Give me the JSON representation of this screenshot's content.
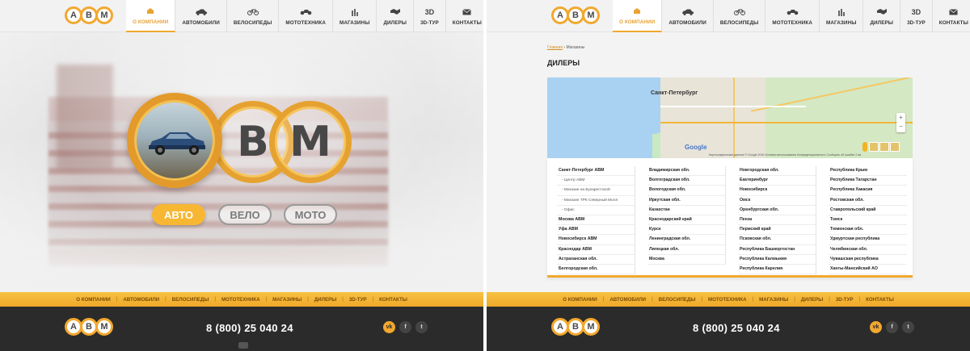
{
  "logo": {
    "letters": [
      "А",
      "В",
      "М"
    ]
  },
  "nav": [
    {
      "label": "О компании",
      "icon": "home-icon"
    },
    {
      "label": "Автомобили",
      "icon": "car-icon"
    },
    {
      "label": "Велосипеды",
      "icon": "bicycle-icon"
    },
    {
      "label": "Мототехника",
      "icon": "motorcycle-icon"
    },
    {
      "label": "Магазины",
      "icon": "shop-icon"
    },
    {
      "label": "Дилеры",
      "icon": "handshake-icon"
    },
    {
      "label": "3D-тур",
      "icon": "3d-icon",
      "icon_text": "3D"
    },
    {
      "label": "Контакты",
      "icon": "envelope-icon"
    }
  ],
  "hero": {
    "ring_letters": [
      "В",
      "М"
    ],
    "buttons": [
      {
        "label": "АВТО"
      },
      {
        "label": "ВЕЛО"
      },
      {
        "label": "МОТО"
      }
    ]
  },
  "footer": {
    "links": [
      "О компании",
      "Автомобили",
      "Велосипеды",
      "Мототехника",
      "Магазины",
      "Дилеры",
      "3D-тур",
      "Контакты"
    ],
    "phone": "8 (800) 25 040 24",
    "social": [
      {
        "label": "vk",
        "icon": "vk-icon"
      },
      {
        "label": "f",
        "icon": "facebook-icon"
      },
      {
        "label": "t",
        "icon": "twitter-icon"
      }
    ]
  },
  "dealers_page": {
    "breadcrumb": {
      "home": "Главная",
      "separator": "›",
      "current": "Магазины"
    },
    "title": "ДИЛЕРЫ",
    "map": {
      "city_label": "Санкт-Петербург",
      "google": "Google",
      "attribution": "Картографические данные © Google 2016   Условия использования   Конфиденциальность   Сообщить об ошибке   2 км",
      "zoom_in": "+",
      "zoom_out": "−"
    },
    "columns": [
      [
        {
          "name": "Санкт-Петербург АВМ",
          "sub": false
        },
        {
          "name": "- Центр АВМ",
          "sub": true
        },
        {
          "name": "- Магазин на Бухарестской",
          "sub": true
        },
        {
          "name": "- Магазин ТРК Северный Молл",
          "sub": true
        },
        {
          "name": "- Офис",
          "sub": true
        },
        {
          "name": "Москва АВМ",
          "sub": false
        },
        {
          "name": "Уфа АВМ",
          "sub": false
        },
        {
          "name": "Новосибирск АВМ",
          "sub": false
        },
        {
          "name": "Краснодар АВМ",
          "sub": false
        },
        {
          "name": "Астраханская обл.",
          "sub": false
        },
        {
          "name": "Белгородская обл.",
          "sub": false
        }
      ],
      [
        {
          "name": "Владимирская обл.",
          "sub": false
        },
        {
          "name": "Волгоградская обл.",
          "sub": false
        },
        {
          "name": "Вологодская обл.",
          "sub": false
        },
        {
          "name": "Иркутская обл.",
          "sub": false
        },
        {
          "name": "Казахстан",
          "sub": false
        },
        {
          "name": "Краснодарский край",
          "sub": false
        },
        {
          "name": "Курск",
          "sub": false
        },
        {
          "name": "Ленинградская обл.",
          "sub": false
        },
        {
          "name": "Липецкая обл.",
          "sub": false
        },
        {
          "name": "Москва",
          "sub": false
        }
      ],
      [
        {
          "name": "Новгородская обл.",
          "sub": false
        },
        {
          "name": "Екатеринбург",
          "sub": false
        },
        {
          "name": "Новосибирск",
          "sub": false
        },
        {
          "name": "Омск",
          "sub": false
        },
        {
          "name": "Оренбургская обл.",
          "sub": false
        },
        {
          "name": "Пенза",
          "sub": false
        },
        {
          "name": "Пермский край",
          "sub": false
        },
        {
          "name": "Псковская обл.",
          "sub": false
        },
        {
          "name": "Республика Башкортостан",
          "sub": false
        },
        {
          "name": "Республика Калмыкия",
          "sub": false
        },
        {
          "name": "Республика Карелия",
          "sub": false
        }
      ],
      [
        {
          "name": "Республика Крым",
          "sub": false
        },
        {
          "name": "Республика Татарстан",
          "sub": false
        },
        {
          "name": "Республика Хакасия",
          "sub": false
        },
        {
          "name": "Ростовская обл.",
          "sub": false
        },
        {
          "name": "Ставропольский край",
          "sub": false
        },
        {
          "name": "Томск",
          "sub": false
        },
        {
          "name": "Тюменская обл.",
          "sub": false
        },
        {
          "name": "Удмуртская республика",
          "sub": false
        },
        {
          "name": "Челябинская обл.",
          "sub": false
        },
        {
          "name": "Чувашская республика",
          "sub": false
        },
        {
          "name": "Ханты-Мансийский АО",
          "sub": false
        }
      ]
    ]
  },
  "colors": {
    "accent": "#f2a82f",
    "footer_dark": "#2b2b2b",
    "text": "#222222"
  }
}
